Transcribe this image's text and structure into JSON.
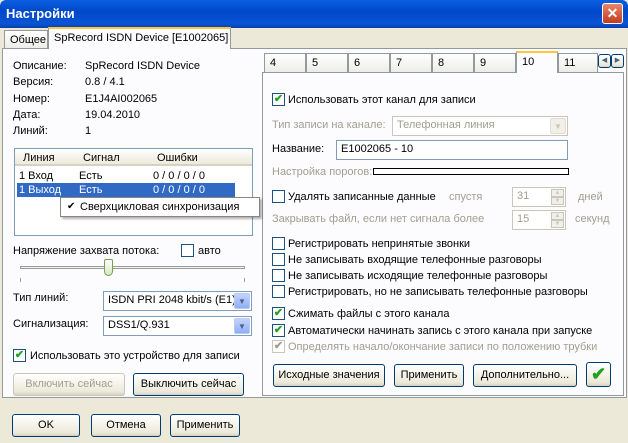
{
  "window": {
    "title": "Настройки",
    "close": "✕"
  },
  "tabs_main": [
    "Общее",
    "SpRecord ISDN Device [E1002065]"
  ],
  "info": {
    "labels": [
      "Описание:",
      "Версия:",
      "Номер:",
      "Дата:",
      "Линий:"
    ],
    "values": [
      "SpRecord ISDN Device",
      "0.8 / 4.1",
      "E1J4AI002065",
      "19.04.2010",
      "1"
    ]
  },
  "lines_table": {
    "headers": [
      "Линия",
      "Сигнал",
      "Ошибки"
    ],
    "rows": [
      [
        "1 Вход",
        "Есть",
        "0 / 0 / 0 / 0"
      ],
      [
        "1 Выход",
        "Есть",
        "0 / 0 / 0 / 0"
      ]
    ]
  },
  "context_menu": {
    "item": "Сверхцикловая синхронизация",
    "check": "✔"
  },
  "capture": {
    "label": "Напряжение захвата потока:",
    "auto_label": "авто"
  },
  "line_type": {
    "label": "Тип линий:",
    "value": "ISDN PRI 2048 kbit/s (E1)"
  },
  "signaling": {
    "label": "Сигнализация:",
    "value": "DSS1/Q.931"
  },
  "use_device": {
    "label": "Использовать это устройство для записи",
    "check": "✔"
  },
  "left_buttons": {
    "enable": "Включить сейчас",
    "disable": "Выключить сейчас"
  },
  "channel_tabs": [
    "4",
    "5",
    "6",
    "7",
    "8",
    "9",
    "10",
    "11"
  ],
  "channel": {
    "use_channel": "Использовать этот канал для записи",
    "record_type_label": "Тип записи на канале:",
    "record_type_value": "Телефонная линия",
    "name_label": "Название:",
    "name_value": "E1002065 - 10",
    "thresholds_label": "Настройка порогов:",
    "delete_label": "Удалять записанные данные",
    "after_label": "спустя",
    "days_value": "31",
    "days_label": "дней",
    "close_file_label": "Закрывать файл, если нет сигнала более",
    "seconds_value": "15",
    "seconds_label": "секунд",
    "options": [
      "Регистрировать непринятые звонки",
      "Не записывать входящие телефонные разговоры",
      "Не записывать исходящие телефонные разговоры",
      "Регистрировать, но не записывать телефонные разговоры"
    ],
    "compress": "Сжимать файлы с этого канала",
    "autostart": "Автоматически начинать запись с этого канала при запуске",
    "detect": "Определять начало/окончание записи по положению трубки",
    "check": "✔"
  },
  "channel_buttons": {
    "defaults": "Исходные значения",
    "apply": "Применить",
    "more": "Дополнительно...",
    "ok_icon": "✔"
  },
  "bottom_buttons": {
    "ok": "OK",
    "cancel": "Отмена",
    "apply": "Применить"
  },
  "arrows": {
    "left": "◀",
    "right": "▶",
    "down": "▼",
    "up": "▲"
  }
}
